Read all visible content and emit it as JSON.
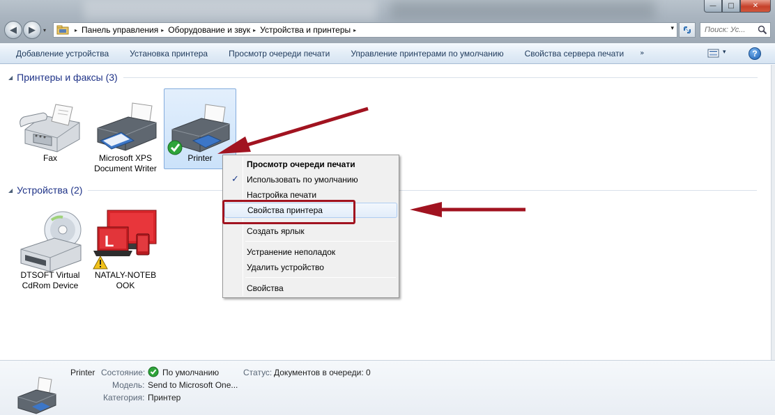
{
  "window": {
    "min_glyph": "—",
    "max_glyph": "□",
    "close_glyph": "✕"
  },
  "nav": {
    "back_glyph": "◀",
    "forward_glyph": "▶",
    "recent_glyph": "▾"
  },
  "breadcrumb": {
    "items": [
      "Панель управления",
      "Оборудование и звук",
      "Устройства и принтеры"
    ],
    "sep": "▸"
  },
  "search": {
    "placeholder": "Поиск: Ус..."
  },
  "commandbar": {
    "items": [
      "Добавление устройства",
      "Установка принтера",
      "Просмотр очереди печати",
      "Управление принтерами по умолчанию",
      "Свойства сервера печати"
    ],
    "more_glyph": "»",
    "help_glyph": "?"
  },
  "groups": {
    "printers": {
      "title": "Принтеры и факсы (3)",
      "collapse_glyph": "◢"
    },
    "devices": {
      "title": "Устройства (2)",
      "collapse_glyph": "◢"
    }
  },
  "printers": [
    {
      "label": "Fax",
      "icon": "fax-icon"
    },
    {
      "label": "Microsoft XPS Document Writer",
      "icon": "printer-icon"
    },
    {
      "label": "Printer",
      "icon": "printer-icon",
      "selected": true,
      "default": true
    }
  ],
  "devices": [
    {
      "label": "DTSOFT Virtual CdRom Device",
      "icon": "cdrom-drive-icon"
    },
    {
      "label": "NATALY-NOTEBOOK",
      "label_line1": "NATALY-NOTEB",
      "label_line2": "OOK",
      "icon": "laptop-icon",
      "warning": true
    }
  ],
  "context_menu": {
    "items": [
      {
        "label": "Просмотр очереди печати",
        "bold": true
      },
      {
        "label": "Использовать по умолчанию",
        "checked": true,
        "check_glyph": "✓"
      },
      {
        "label": "Настройка печати"
      },
      {
        "label": "Свойства принтера",
        "highlighted": true
      },
      {
        "label": "Создать ярлык"
      },
      {
        "label": "Устранение неполадок"
      },
      {
        "label": "Удалить устройство"
      },
      {
        "label": "Свойства"
      }
    ]
  },
  "details": {
    "name": "Printer",
    "state_label": "Состояние:",
    "state_value": "По умолчанию",
    "status_label": "Статус:",
    "status_value": "Документов в очереди: 0",
    "model_label": "Модель:",
    "model_value": "Send to Microsoft One...",
    "category_label": "Категория:",
    "category_value": "Принтер"
  },
  "colors": {
    "annotation_red": "#a11320",
    "group_title": "#1e3287",
    "command_text": "#1e395b"
  }
}
